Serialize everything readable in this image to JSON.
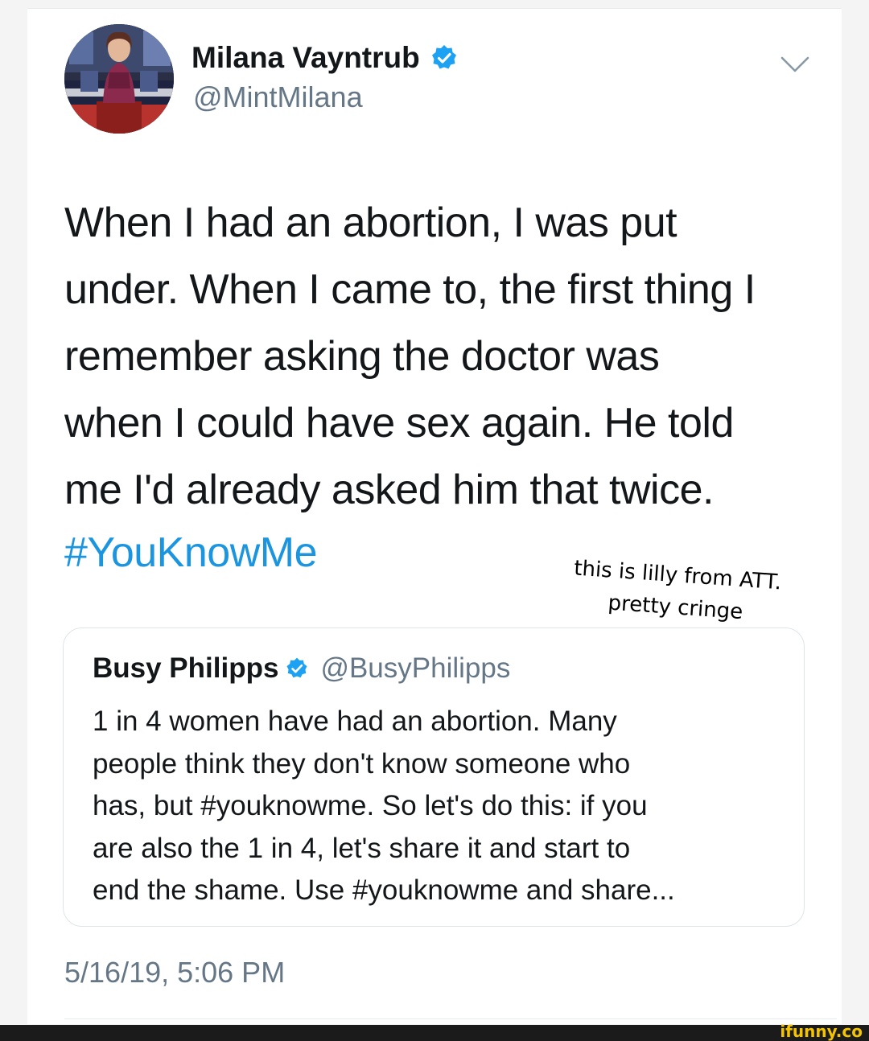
{
  "tweet": {
    "author": {
      "display_name": "Milana Vayntrub",
      "handle": "@MintMilana",
      "avatar_icon": "profile-photo",
      "verified_icon": "verified-badge-icon",
      "verified_color": "#1da1f2"
    },
    "menu_icon": "chevron-down-icon",
    "text_lines": [
      "When I had an abortion, I was put",
      "under. When I came to, the first thing I",
      "remember asking the doctor was",
      "when I could have sex again. He told",
      "me I'd already asked him that twice."
    ],
    "hashtag": "#YouKnowMe",
    "timestamp": "5/16/19, 5:06 PM"
  },
  "overlay_caption": {
    "line1": "this is lilly from ATT.",
    "line2": "pretty cringe"
  },
  "quoted_tweet": {
    "display_name": "Busy Philipps",
    "handle": "@BusyPhilipps",
    "verified_icon": "verified-badge-icon",
    "text_lines": [
      "1 in 4 women have had an abortion. Many",
      "people think they don't know someone who",
      "has, but #youknowme. So let's do this: if you",
      "are also the 1 in 4, let's share it and start to",
      "end the shame. Use #youknowme and share..."
    ]
  },
  "watermark": "ifunny.co",
  "colors": {
    "link_blue": "#1b95e0",
    "secondary_gray": "#657786",
    "watermark_yellow": "#f5c400",
    "footer_black": "#1b1b1b"
  }
}
